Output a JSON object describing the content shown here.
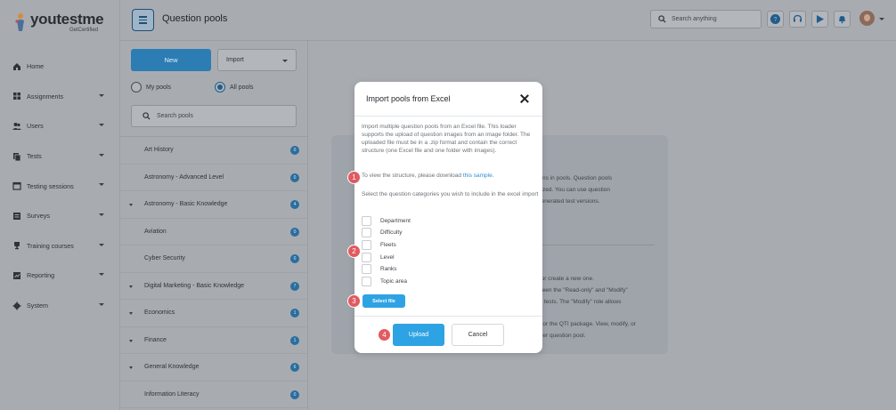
{
  "brand": {
    "name": "youtestme",
    "sub": "GetCertified"
  },
  "sidebar": {
    "items": [
      {
        "label": "Home",
        "icon": "home-icon",
        "has_chevron": false
      },
      {
        "label": "Assignments",
        "icon": "assignments-icon",
        "has_chevron": true
      },
      {
        "label": "Users",
        "icon": "users-icon",
        "has_chevron": true
      },
      {
        "label": "Tests",
        "icon": "tests-icon",
        "has_chevron": true
      },
      {
        "label": "Testing sessions",
        "icon": "testing-sessions-icon",
        "has_chevron": true
      },
      {
        "label": "Surveys",
        "icon": "surveys-icon",
        "has_chevron": true
      },
      {
        "label": "Training courses",
        "icon": "trophy-icon",
        "has_chevron": true
      },
      {
        "label": "Reporting",
        "icon": "reporting-icon",
        "has_chevron": true
      },
      {
        "label": "System",
        "icon": "gear-icon",
        "has_chevron": true
      }
    ]
  },
  "header": {
    "title": "Question pools",
    "search_placeholder": "Search anything"
  },
  "pools_panel": {
    "new_label": "New",
    "import_label": "Import",
    "radio_my": "My pools",
    "radio_all": "All pools",
    "search_placeholder": "Search pools",
    "items": [
      {
        "name": "Art History",
        "badge": "0",
        "expandable": false
      },
      {
        "name": "Astronomy - Advanced Level",
        "badge": "0",
        "expandable": false
      },
      {
        "name": "Astronomy - Basic Knowledge",
        "badge": "4",
        "expandable": true
      },
      {
        "name": "Aviation",
        "badge": "0",
        "expandable": false
      },
      {
        "name": "Cyber Security",
        "badge": "0",
        "expandable": false
      },
      {
        "name": "Digital Marketing - Basic Knowledge",
        "badge": "7",
        "expandable": true
      },
      {
        "name": "Economics",
        "badge": "1",
        "expandable": true
      },
      {
        "name": "Finance",
        "badge": "1",
        "expandable": true
      },
      {
        "name": "General Knowledge",
        "badge": "6",
        "expandable": true
      },
      {
        "name": "Information Literacy",
        "badge": "0",
        "expandable": false
      }
    ]
  },
  "background_card": {
    "lines": [
      "ions in pools. Question pools",
      "nized. You can use question",
      "generated test versions.",
      "t or create a new one.",
      "ween the \"Read-only\" and \"Modify\"",
      "in tests. The \"Modify\" role allows",
      "e or the QTI package. View, modify, or",
      "ther question pool."
    ]
  },
  "modal": {
    "title": "Import pools from Excel",
    "description": "Import multiple question pools from an Excel file. This loader supports the upload of question images from an image folder. The uploaded file must be in a .zip format and contain the correct structure (one Excel file and one folder with images).",
    "structure_prefix": "To view the structure, please download",
    "structure_link": "this sample.",
    "categories_prompt": "Select the question categories you wish to include in the excel import",
    "categories": [
      "Department",
      "Difficulty",
      "Fleets",
      "Level",
      "Ranks",
      "Topic area"
    ],
    "select_file_label": "Select file",
    "upload_label": "Upload",
    "cancel_label": "Cancel"
  },
  "steps": [
    "1",
    "2",
    "3",
    "4"
  ]
}
